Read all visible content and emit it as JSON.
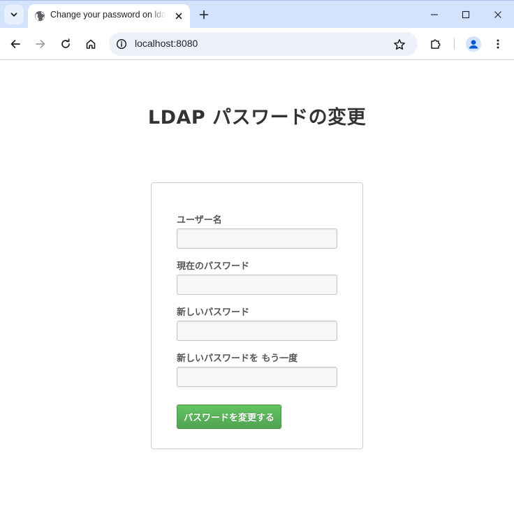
{
  "browser": {
    "tab": {
      "title": "Change your password on ldap",
      "favicon": "globe-icon"
    },
    "address_bar": {
      "url": "localhost:8080"
    },
    "icons": {
      "tab_search": "chevron-down-icon",
      "tab_close": "close-icon",
      "new_tab": "plus-icon",
      "minimize": "minimize-icon",
      "maximize": "maximize-icon",
      "window_close": "close-icon",
      "back": "back-arrow-icon",
      "forward": "forward-arrow-icon",
      "reload": "reload-icon",
      "home": "home-icon",
      "site_info": "info-icon",
      "bookmark": "star-icon",
      "extensions": "puzzle-icon",
      "profile": "person-icon",
      "menu": "kebab-menu-icon"
    },
    "colors": {
      "tabbar": "#d3e3fd",
      "omnibox": "#edf2fa"
    }
  },
  "page": {
    "title": "LDAP パスワードの変更",
    "form": {
      "fields": [
        {
          "label": "ユーザー名",
          "value": ""
        },
        {
          "label": "現在のパスワード",
          "value": ""
        },
        {
          "label": "新しいパスワード",
          "value": ""
        },
        {
          "label": "新しいパスワードを もう一度",
          "value": ""
        }
      ],
      "submit_label": "パスワードを変更する"
    },
    "colors": {
      "submit_button": "#5bb75b",
      "title_text": "#333333"
    }
  }
}
